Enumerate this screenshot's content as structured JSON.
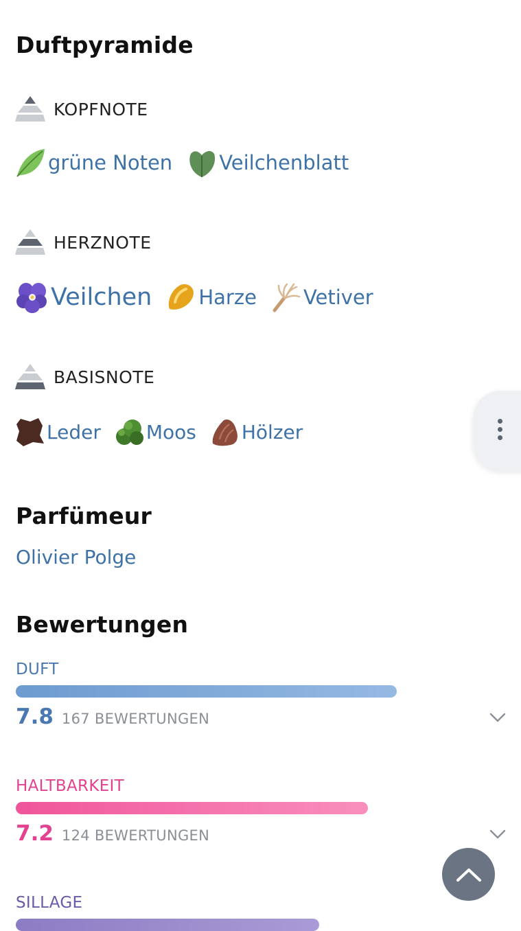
{
  "pyramid": {
    "title": "Duftpyramide",
    "top": {
      "label": "KOPFNOTE",
      "icon": "pyramid-top-icon",
      "notes": [
        {
          "label": "grüne Noten",
          "icon": "green-leaf-icon"
        },
        {
          "label": "Veilchenblatt",
          "icon": "violet-leaf-icon"
        }
      ]
    },
    "heart": {
      "label": "HERZNOTE",
      "icon": "pyramid-heart-icon",
      "notes": [
        {
          "label": "Veilchen",
          "icon": "violet-flower-icon"
        },
        {
          "label": "Harze",
          "icon": "resin-icon"
        },
        {
          "label": "Vetiver",
          "icon": "vetiver-root-icon"
        }
      ]
    },
    "base": {
      "label": "BASISNOTE",
      "icon": "pyramid-base-icon",
      "notes": [
        {
          "label": "Leder",
          "icon": "leather-icon"
        },
        {
          "label": "Moos",
          "icon": "moss-icon"
        },
        {
          "label": "Hölzer",
          "icon": "wood-icon"
        }
      ]
    }
  },
  "perfumer": {
    "title": "Parfümeur",
    "name": "Olivier Polge"
  },
  "ratings": {
    "title": "Bewertungen",
    "items": [
      {
        "label": "DUFT",
        "score": "7.8",
        "count": "167 BEWERTUNGEN",
        "fraction": 0.78,
        "color": "#6d9bd0"
      },
      {
        "label": "HALTBARKEIT",
        "score": "7.2",
        "count": "124 BEWERTUNGEN",
        "fraction": 0.72,
        "color": "#f06aa5"
      },
      {
        "label": "SILLAGE",
        "color": "#8c7cc4"
      }
    ]
  },
  "colors": {
    "link": "#3e72a7",
    "duft": "#4a78b0",
    "haltbarkeit": "#e2428f",
    "sillage": "#6a5aa8",
    "fab": "#6a7482"
  },
  "icons": {
    "side_menu": "more-vertical-icon",
    "scroll_top": "chevron-up-icon",
    "expand": "chevron-down-icon"
  }
}
